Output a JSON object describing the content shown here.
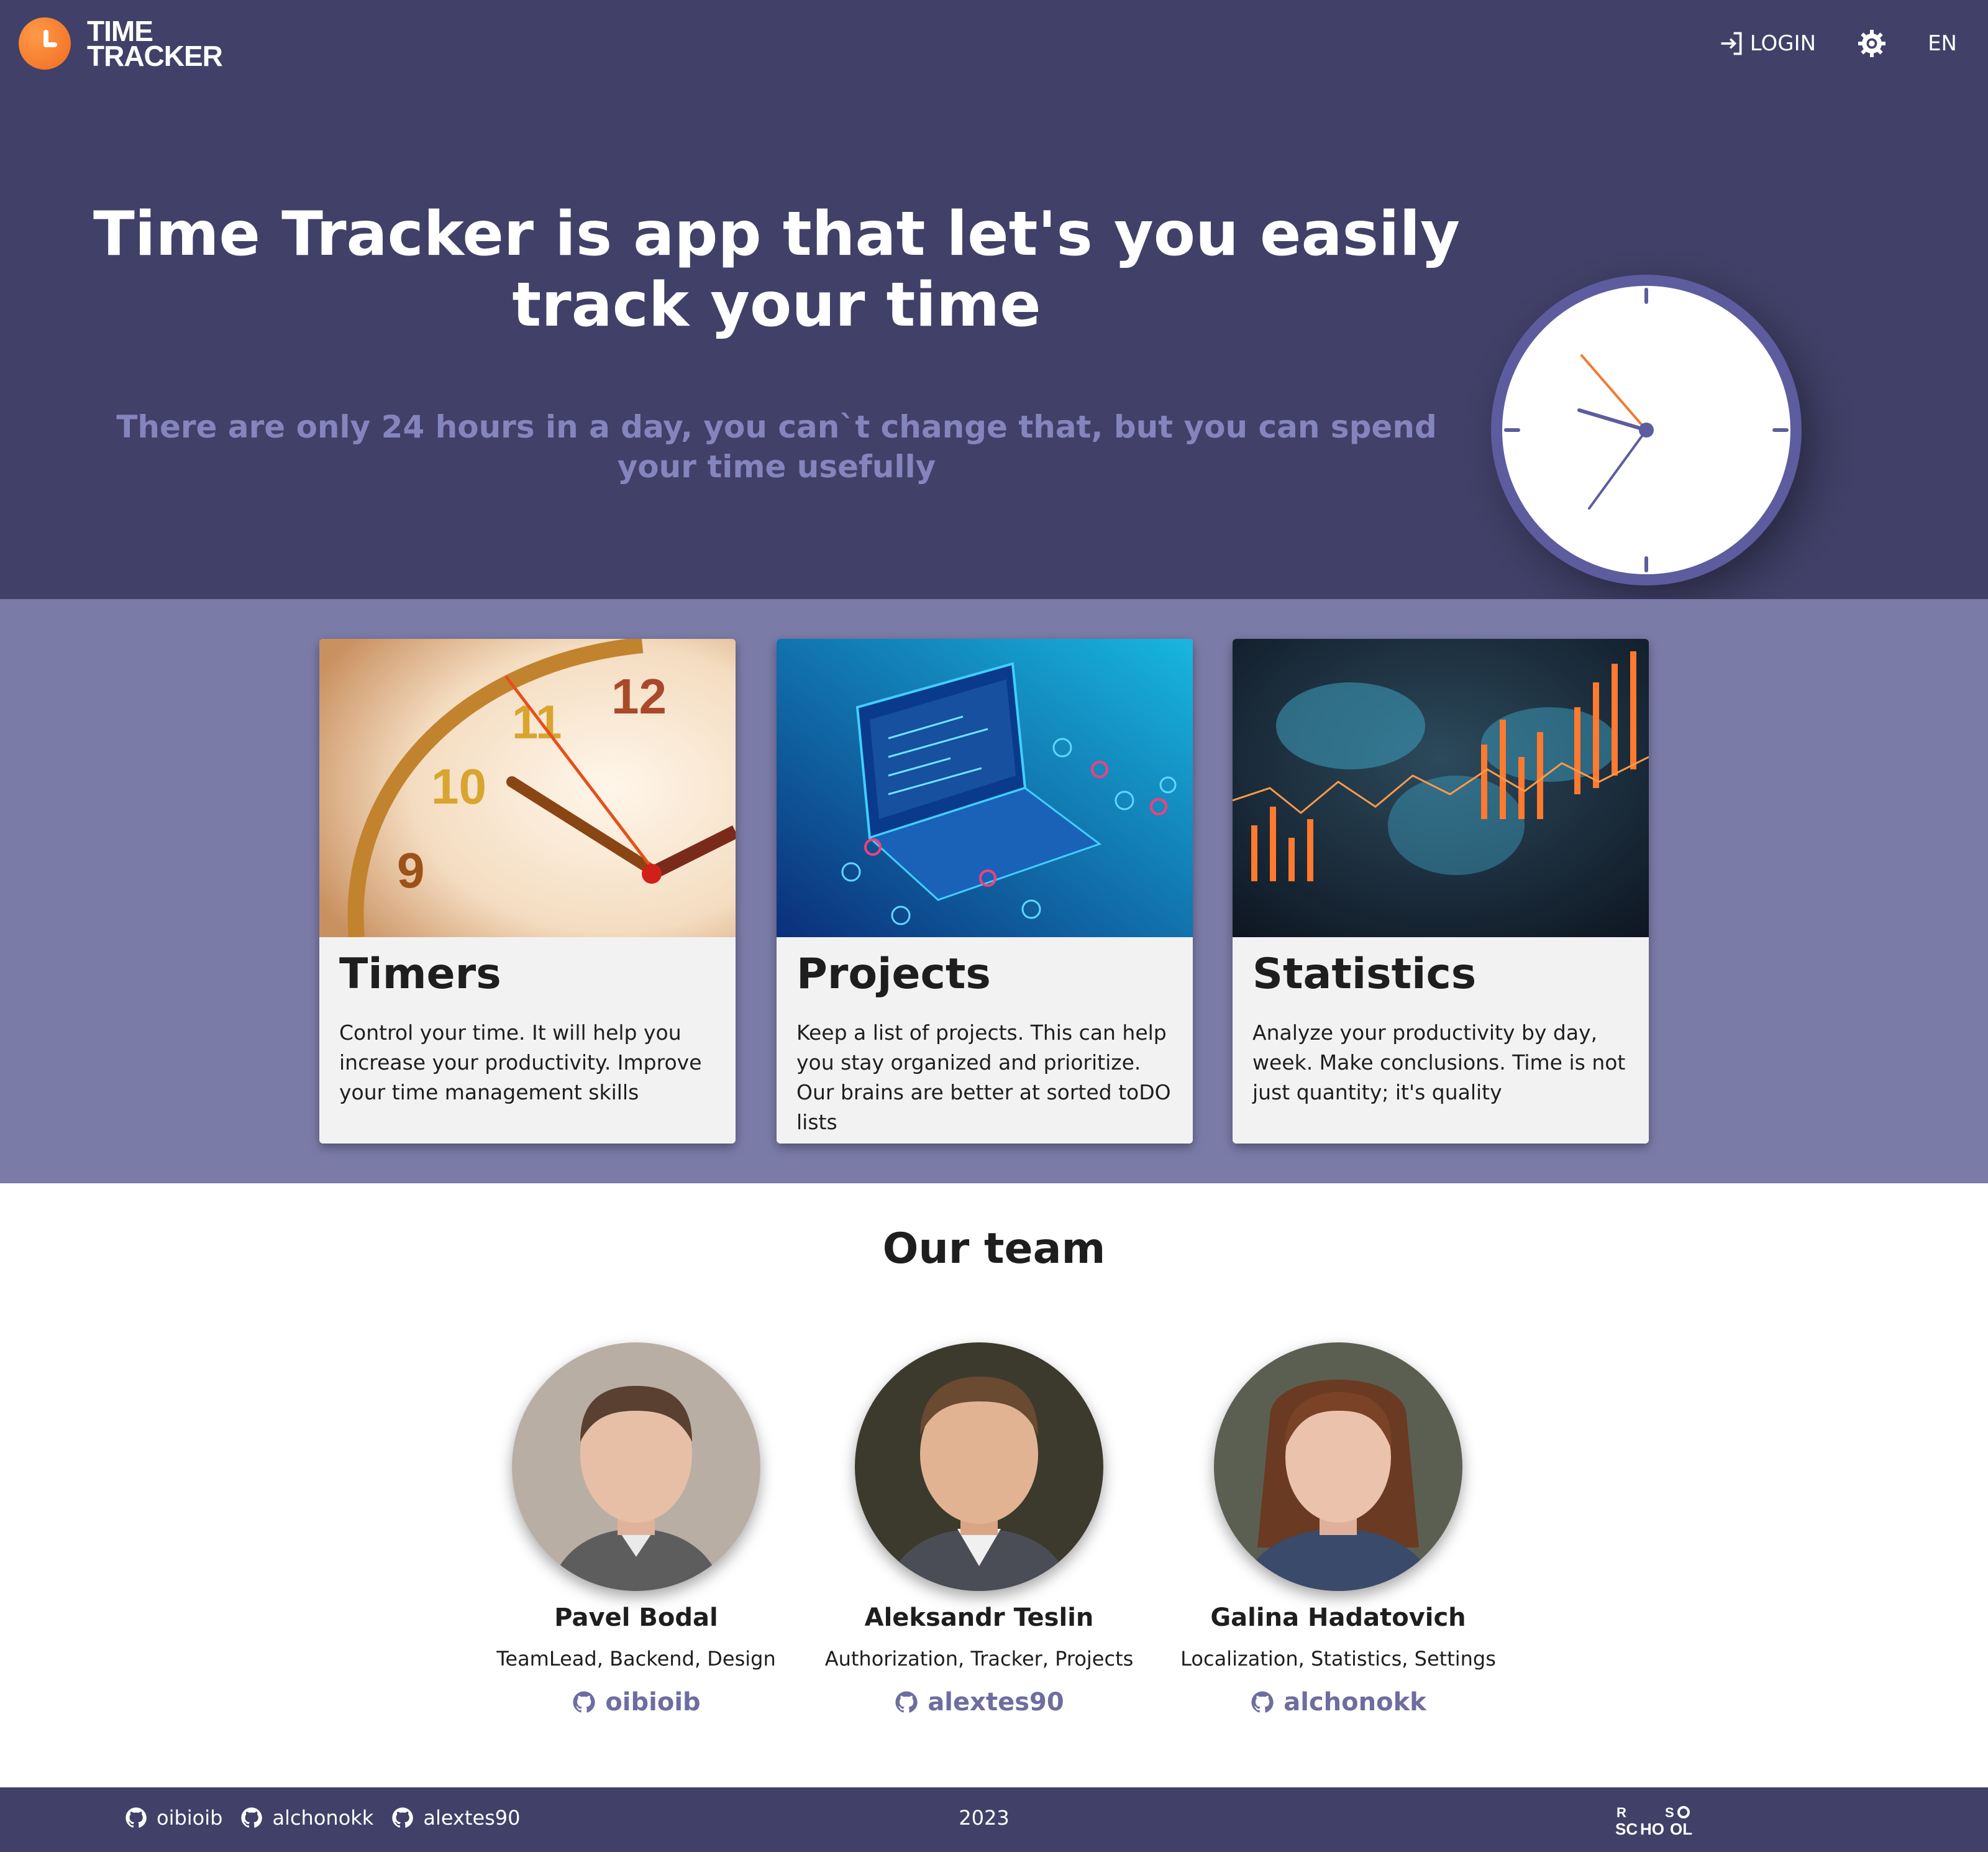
{
  "app": {
    "logo_line1": "TIME",
    "logo_line2": "TRACKER"
  },
  "nav": {
    "login_label": "LOGIN",
    "theme_icon": "gear-icon",
    "language": "EN"
  },
  "hero": {
    "title": "Time Tracker is app that let's you easily track your time",
    "subtitle": "There are only 24 hours in a day, you can`t change that, but you can spend your time usefully"
  },
  "features": [
    {
      "title": "Timers",
      "text": "Control your time. It will help you increase your productivity. Improve your time management skills"
    },
    {
      "title": "Projects",
      "text": "Keep a list of projects. This can help you stay organized and prioritize. Our brains are better at sorted toDO lists"
    },
    {
      "title": "Statistics",
      "text": "Analyze your productivity by day, week. Make conclusions. Time is not just quantity; it's quality"
    }
  ],
  "team": {
    "title": "Our team",
    "members": [
      {
        "name": "Pavel Bodal",
        "role": "TeamLead, Backend, Design",
        "github": "oibioib"
      },
      {
        "name": "Aleksandr Teslin",
        "role": "Authorization, Tracker, Projects",
        "github": "alextes90"
      },
      {
        "name": "Galina Hadatovich",
        "role": "Localization, Statistics, Settings",
        "github": "alchonokk"
      }
    ]
  },
  "footer": {
    "links": [
      "oibioib",
      "alchonokk",
      "alextes90"
    ],
    "year": "2023",
    "school_logo_text": "RS SCHOOL"
  },
  "colors": {
    "header_bg": "#404068",
    "features_bg": "#7b7ba8",
    "accent_orange": "#f07a2e",
    "link_purple": "#6d6da0"
  }
}
